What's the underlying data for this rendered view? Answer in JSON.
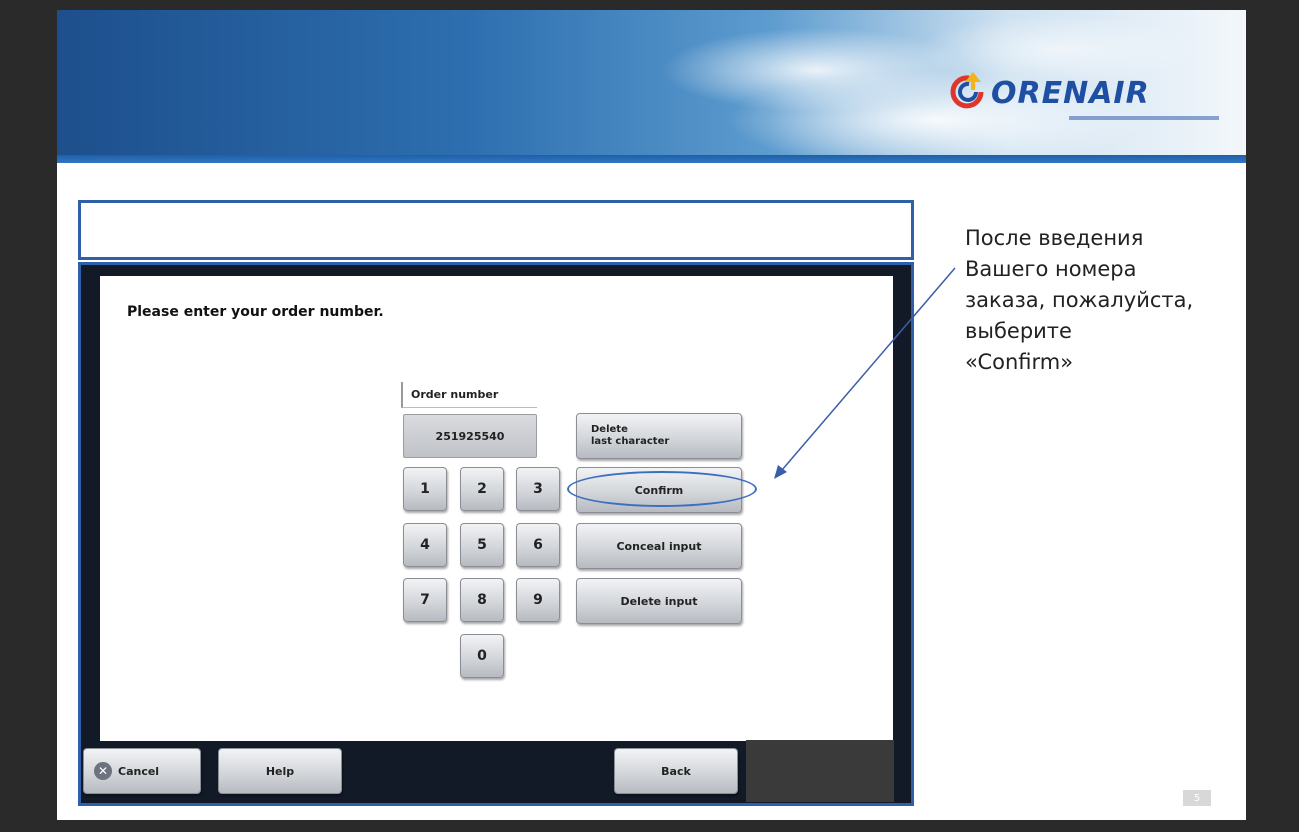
{
  "brand": {
    "logo_text": "ORENAIR",
    "logo_tagline": "ОРЕНБУРГСКИЕ АВИАЛИНИИ"
  },
  "kiosk": {
    "prompt": "Please enter your order number.",
    "field_label": "Order number",
    "field_value": "251925540",
    "keypad": [
      "1",
      "2",
      "3",
      "4",
      "5",
      "6",
      "7",
      "8",
      "9",
      "0"
    ],
    "actions": {
      "delete_last_line1": "Delete",
      "delete_last_line2": "last character",
      "confirm": "Confirm",
      "conceal": "Conceal input",
      "delete_input": "Delete input"
    },
    "footer": {
      "cancel": "Cancel",
      "help": "Help",
      "back": "Back"
    }
  },
  "annotation": {
    "lines": [
      "После введения",
      "Вашего номера",
      "заказа, пожалуйста,",
      "выберите",
      "«Confirm»"
    ]
  },
  "page_number": "5",
  "colors": {
    "accent_blue": "#2f5fa8",
    "highlight": "#3d6fc0",
    "logo_blue": "#1f4fa3",
    "logo_red": "#e0352b",
    "logo_yellow": "#f2b31b"
  }
}
